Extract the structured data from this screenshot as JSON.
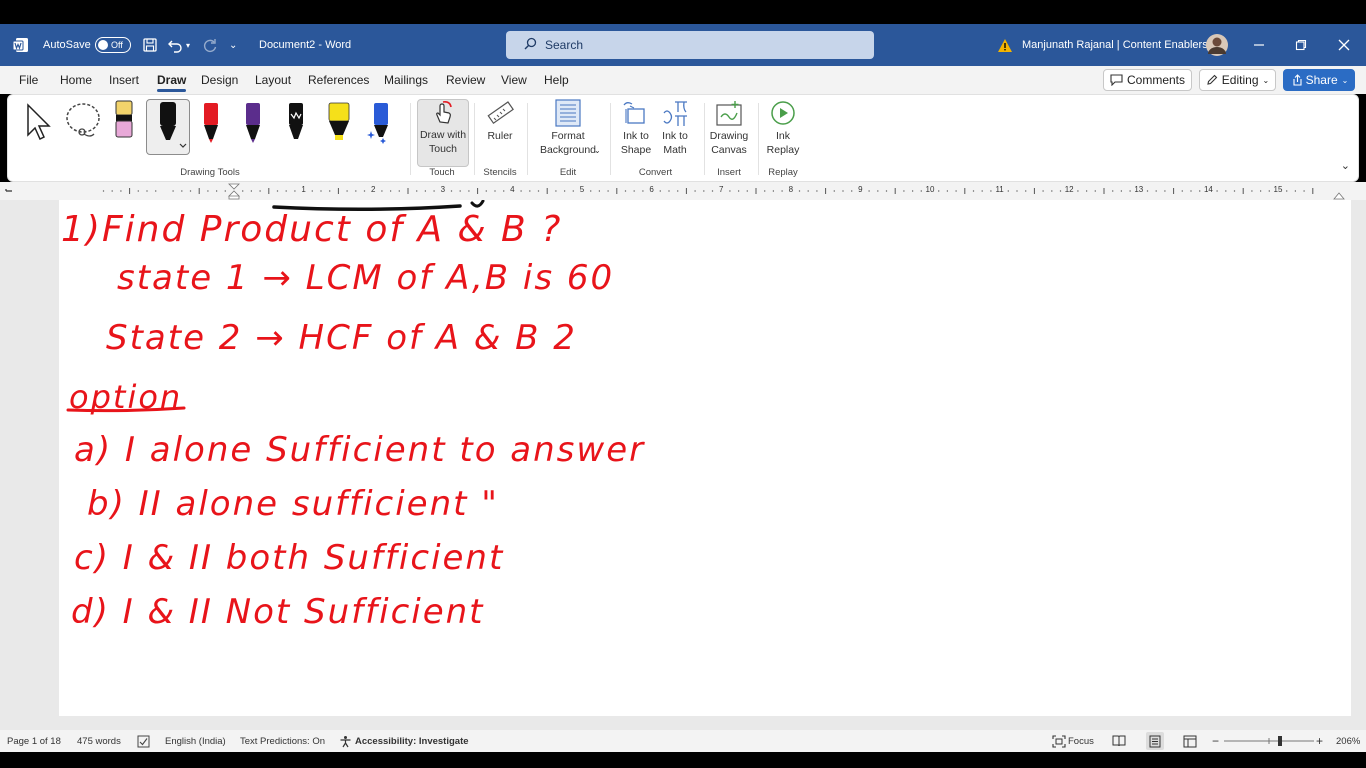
{
  "titlebar": {
    "autosave_label": "AutoSave",
    "autosave_state": "Off",
    "doc_title": "Document2",
    "separator": "-",
    "app_name": "Word",
    "search_placeholder": "Search",
    "user_name": "Manjunath Rajanal | Content Enablers"
  },
  "menu": {
    "tabs": [
      "File",
      "Home",
      "Insert",
      "Draw",
      "Design",
      "Layout",
      "References",
      "Mailings",
      "Review",
      "View",
      "Help"
    ],
    "active_tab": "Draw",
    "comments_label": "Comments",
    "editing_label": "Editing",
    "share_label": "Share"
  },
  "ribbon": {
    "groups": {
      "drawing_tools": "Drawing Tools",
      "touch": "Touch",
      "stencils": "Stencils",
      "edit": "Edit",
      "convert": "Convert",
      "insert": "Insert",
      "replay": "Replay"
    },
    "buttons": {
      "draw_with_touch_1": "Draw with",
      "draw_with_touch_2": "Touch",
      "ruler": "Ruler",
      "format_bg_1": "Format",
      "format_bg_2": "Background",
      "ink_to_shape_1": "Ink to",
      "ink_to_shape_2": "Shape",
      "ink_to_math_1": "Ink to",
      "ink_to_math_2": "Math",
      "drawing_canvas_1": "Drawing",
      "drawing_canvas_2": "Canvas",
      "ink_replay_1": "Ink",
      "ink_replay_2": "Replay"
    },
    "pen_colors": [
      "#111111",
      "#e31b23",
      "#5b2d8c",
      "#111111",
      "#f5e01a",
      "#2a5bd7"
    ]
  },
  "ruler": {
    "numbers": [
      "1",
      "2",
      "3",
      "4",
      "5",
      "6",
      "7",
      "8",
      "9",
      "10",
      "11",
      "12",
      "13",
      "14",
      "15"
    ]
  },
  "ink": {
    "color": "#e8141a",
    "lines": [
      "1)Find Product of A & B ?",
      "state 1 → LCM of A,B is 60",
      "State 2 → HCF of A & B 2",
      "option",
      "a) I alone Sufficient to answer",
      "b) II alone sufficient \"",
      "c) I & II both Sufficient",
      "d) I & II Not Sufficient"
    ]
  },
  "status": {
    "page": "Page 1 of 18",
    "words": "475 words",
    "language": "English (India)",
    "text_predictions": "Text Predictions: On",
    "accessibility": "Accessibility: Investigate",
    "focus": "Focus",
    "zoom": "206%",
    "zoom_minus": "−",
    "zoom_plus": "+"
  }
}
